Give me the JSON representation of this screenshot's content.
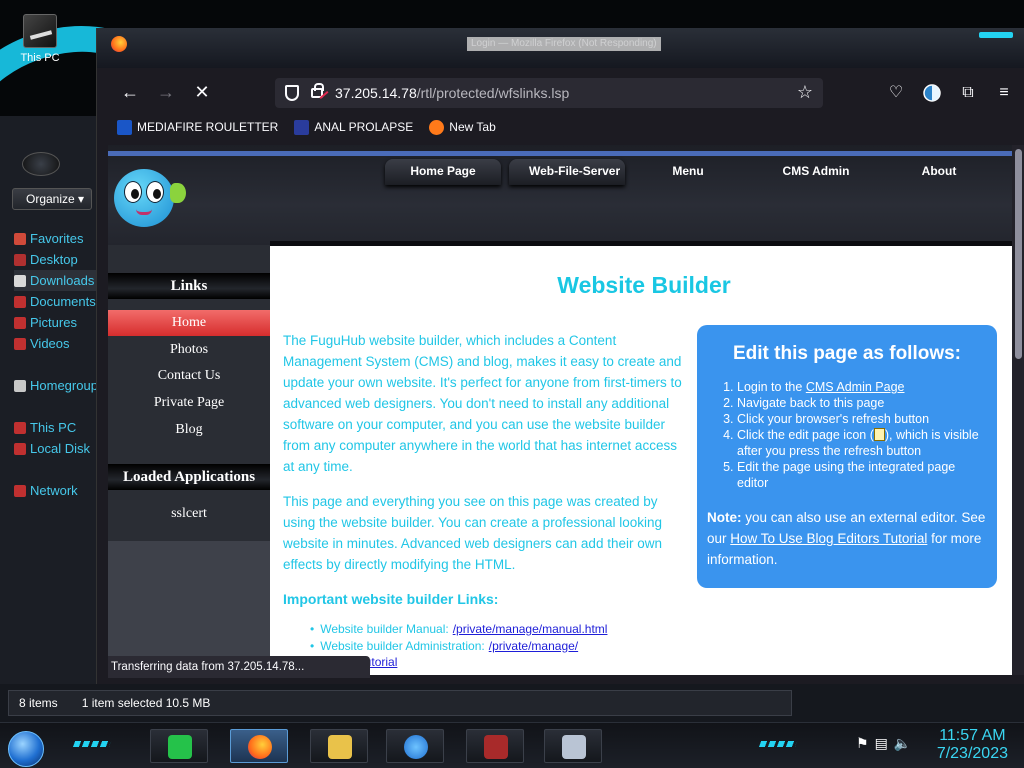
{
  "desktop": {
    "icon_label": "This PC"
  },
  "explorer": {
    "organize_label": "Organize",
    "nav_items": [
      {
        "label": "Favorites",
        "color": "#d04a3a"
      },
      {
        "label": "Desktop",
        "color": "#b03030"
      },
      {
        "label": "Downloads",
        "color": "#d8d8d8",
        "selected": true
      },
      {
        "label": "Documents",
        "color": "#c03030"
      },
      {
        "label": "Pictures",
        "color": "#c03030"
      },
      {
        "label": "Videos",
        "color": "#c03030"
      },
      {
        "label": "",
        "gap": true
      },
      {
        "label": "Homegroup",
        "color": "#c8c8c8"
      },
      {
        "label": "",
        "gap": true
      },
      {
        "label": "This PC",
        "color": "#c03030"
      },
      {
        "label": "Local Disk",
        "color": "#c03030"
      },
      {
        "label": "",
        "gap": true
      },
      {
        "label": "Network",
        "color": "#c03030"
      }
    ],
    "status": {
      "items": "8 items",
      "selected": "1 item selected  10.5 MB"
    }
  },
  "browser": {
    "window_title": "Login — Mozilla Firefox (Not Responding)",
    "url_host": "37.205.14.78",
    "url_path": "/rtl/protected/wfslinks.lsp",
    "bookmarks": [
      {
        "label": "MEDIAFIRE ROULETTER",
        "icon": "mediafire-icon",
        "color": "#1a56c7"
      },
      {
        "label": "ANAL PROLAPSE",
        "icon": "bookmark-chevron-icon",
        "color": "#2a3c9c"
      },
      {
        "label": "New Tab",
        "icon": "firefox-icon",
        "color": "#ff7a1a"
      }
    ],
    "status_text": "Transferring data from 37.205.14.78..."
  },
  "site": {
    "top_nav": [
      "Home Page",
      "Web-File-Server",
      "Menu",
      "CMS Admin",
      "About"
    ],
    "links_heading": "Links",
    "links": [
      "Home",
      "Photos",
      "Contact Us",
      "Private Page",
      "Blog"
    ],
    "loaded_apps_heading": "Loaded Applications",
    "loaded_apps": [
      "sslcert"
    ],
    "title": "Website Builder",
    "intro_p1": "The FuguHub website builder, which includes a Content Management System (CMS) and blog, makes it easy to create and update your own website. It's perfect for anyone from first-timers to advanced web designers. You don't need to install any additional software on your computer, and you can use the website builder from any computer anywhere in the world that has internet access at any time.",
    "intro_p2": "This page and everything you see on this page was created by using the website builder. You can create a professional looking website in minutes. Advanced web designers can add their own effects by directly modifying the HTML.",
    "links_section_heading": "Important website builder Links:",
    "builder_links": [
      {
        "label": "Website builder Manual:",
        "href_text": "/private/manage/manual.html"
      },
      {
        "label": "Website builder Administration:",
        "href_text": "/private/manage/"
      },
      {
        "label": "",
        "href_text": "Video Tutorial"
      }
    ],
    "edit_box": {
      "heading": "Edit this page as follows:",
      "step1_pre": "Login to the ",
      "step1_link": "CMS Admin Page",
      "step2": "Navigate back to this page",
      "step3": "Click your browser's refresh button",
      "step4_pre": "Click the edit page icon (",
      "step4_post": "), which is visible after you press the refresh button",
      "step5": "Edit the page using the integrated page editor",
      "note_label": "Note:",
      "note_pre": " you can also use an external editor. See our ",
      "note_link": "How To Use Blog Editors Tutorial",
      "note_post": " for more information."
    }
  },
  "taskbar": {
    "time": "11:57 AM",
    "date": "7/23/2023"
  },
  "colors": {
    "accent_cyan": "#23d3f2",
    "site_heading": "#19c7e3",
    "edit_box_bg": "#3a94ee",
    "active_rail": "#e04848"
  }
}
